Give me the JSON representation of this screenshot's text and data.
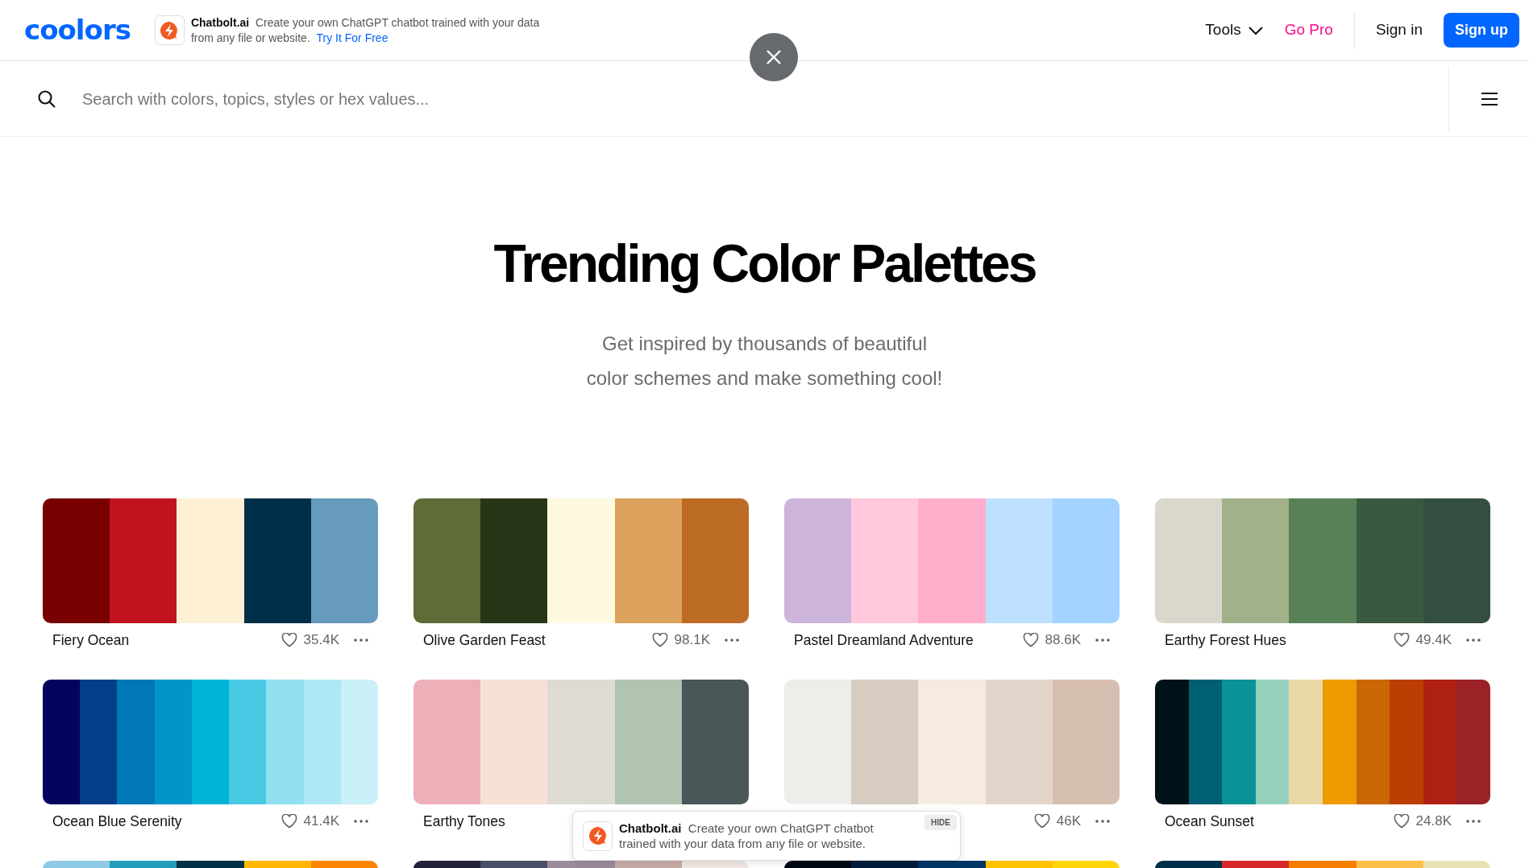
{
  "header": {
    "logo": "coolors",
    "ad": {
      "brand": "Chatbolt.ai",
      "text": "Create your own ChatGPT chatbot trained with your data from any file or website.",
      "link": "Try It For Free"
    },
    "nav": {
      "tools": "Tools",
      "go_pro": "Go Pro",
      "sign_in": "Sign in",
      "sign_up": "Sign up"
    }
  },
  "search": {
    "placeholder": "Search with colors, topics, styles or hex values..."
  },
  "hero": {
    "title": "Trending Color Palettes",
    "subtitle_lines": [
      "Get inspired by thousands of beautiful",
      "color schemes and make something cool!"
    ]
  },
  "palettes": [
    {
      "name": "Fiery Ocean",
      "likes": "35.4K",
      "colors": [
        {
          "color": "#780000"
        },
        {
          "color": "#c1121f"
        },
        {
          "color": "#fdf0d5"
        },
        {
          "color": "#003049"
        },
        {
          "color": "#669bbc"
        }
      ]
    },
    {
      "name": "Olive Garden Feast",
      "likes": "98.1K",
      "colors": [
        {
          "color": "#606c38"
        },
        {
          "color": "#283618"
        },
        {
          "color": "#fefae0"
        },
        {
          "color": "#dda15e"
        },
        {
          "color": "#bc6c25"
        }
      ]
    },
    {
      "name": "Pastel Dreamland Adventure",
      "likes": "88.6K",
      "colors": [
        {
          "color": "#cdb4db"
        },
        {
          "color": "#ffc8dd"
        },
        {
          "color": "#ffafcc"
        },
        {
          "color": "#bde0fe"
        },
        {
          "color": "#a2d2ff"
        }
      ]
    },
    {
      "name": "Earthy Forest Hues",
      "likes": "49.4K",
      "colors": [
        {
          "color": "#dad7cd"
        },
        {
          "color": "#a3b18a"
        },
        {
          "color": "#588157"
        },
        {
          "color": "#3a5a40"
        },
        {
          "color": "#344e41"
        }
      ]
    },
    {
      "name": "Ocean Blue Serenity",
      "likes": "41.4K",
      "colors": [
        {
          "color": "#03045e"
        },
        {
          "color": "#023e8a"
        },
        {
          "color": "#0077b6"
        },
        {
          "color": "#0096c7"
        },
        {
          "color": "#00b4d8"
        },
        {
          "color": "#48cae4"
        },
        {
          "color": "#90e0ef"
        },
        {
          "color": "#ade8f4"
        },
        {
          "color": "#caf0f8"
        }
      ]
    },
    {
      "name": "Earthy Tones",
      "colors": [
        {
          "color": "#edafb8"
        },
        {
          "color": "#f7e1d7"
        },
        {
          "color": "#dedbd2"
        },
        {
          "color": "#b0c4b1"
        },
        {
          "color": "#4a5759"
        }
      ]
    },
    {
      "likes": "46K",
      "colors": [
        {
          "color": "#edede9"
        },
        {
          "color": "#d6ccc2"
        },
        {
          "color": "#f5ebe0"
        },
        {
          "color": "#e3d5ca"
        },
        {
          "color": "#d5bdaf"
        }
      ]
    },
    {
      "name": "Ocean Sunset",
      "likes": "24.8K",
      "colors": [
        {
          "color": "#001219"
        },
        {
          "color": "#005f73"
        },
        {
          "color": "#0a9396"
        },
        {
          "color": "#94d2bd"
        },
        {
          "color": "#e9d8a6"
        },
        {
          "color": "#ee9b00"
        },
        {
          "color": "#ca6702"
        },
        {
          "color": "#bb3e03"
        },
        {
          "color": "#ae2012"
        },
        {
          "color": "#9b2226"
        }
      ]
    },
    {
      "colors": [
        {
          "color": "#8ecae6"
        },
        {
          "color": "#219ebc"
        },
        {
          "color": "#023047"
        },
        {
          "color": "#ffb703"
        },
        {
          "color": "#fb8500"
        }
      ]
    },
    {
      "colors": [
        {
          "color": "#22223b"
        },
        {
          "color": "#4a4e69"
        },
        {
          "color": "#9a8c98"
        },
        {
          "color": "#c9ada7"
        },
        {
          "color": "#f2e9e4"
        }
      ]
    },
    {
      "colors": [
        {
          "color": "#000814"
        },
        {
          "color": "#001d3d"
        },
        {
          "color": "#003566"
        },
        {
          "color": "#ffc300"
        },
        {
          "color": "#ffd60a"
        }
      ]
    },
    {
      "colors": [
        {
          "color": "#003049"
        },
        {
          "color": "#d62828"
        },
        {
          "color": "#f77f00"
        },
        {
          "color": "#fcbf49"
        },
        {
          "color": "#eae2b7"
        }
      ]
    }
  ],
  "popup": {
    "brand": "Chatbolt.ai",
    "text": "Create your own ChatGPT chatbot trained with your data from any file or website.",
    "hide": "HIDE"
  }
}
